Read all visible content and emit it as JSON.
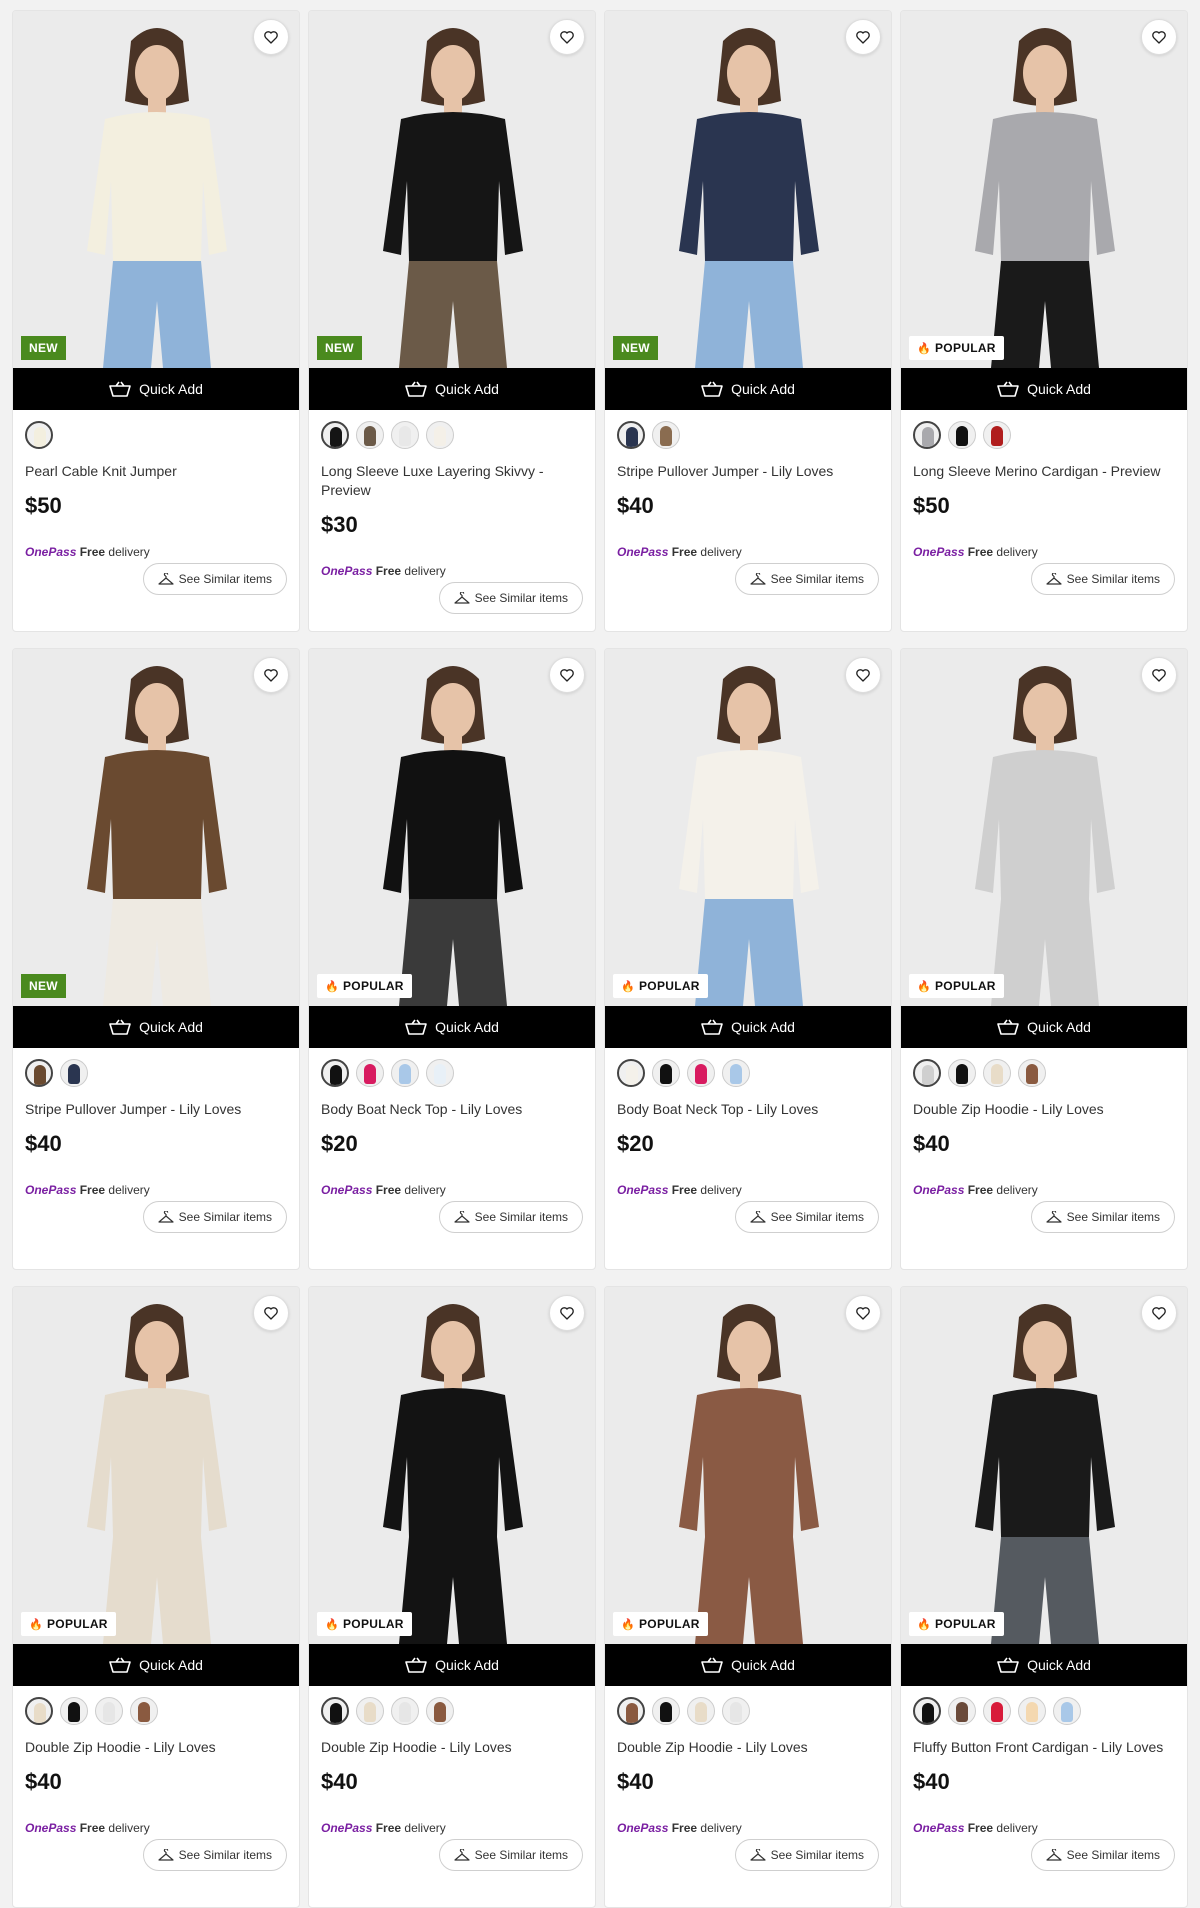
{
  "quick_add_label": "Quick Add",
  "similar_label": "See Similar items",
  "delivery": {
    "brand": "OnePass",
    "free": "Free",
    "text": "delivery"
  },
  "colors": {
    "new_badge": "#4a8a1e",
    "onepass": "#7a1fa2",
    "quick_bar": "#000000"
  },
  "products": [
    {
      "name": "Pearl Cable Knit Jumper",
      "price": "$50",
      "badge": "NEW",
      "top": "#f3efdf",
      "bottom": "#8fb3d9",
      "swatches": [
        "#f3efdf"
      ]
    },
    {
      "name": "Long Sleeve Luxe Layering Skivvy - Preview",
      "price": "$30",
      "badge": "NEW",
      "top": "#151515",
      "bottom": "#6b5a48",
      "swatches": [
        "#151515",
        "#6b5a48",
        "#e8e8e8",
        "#f4f0e8"
      ]
    },
    {
      "name": "Stripe Pullover Jumper - Lily Loves",
      "price": "$40",
      "badge": "NEW",
      "top": "#2a3550",
      "bottom": "#8fb3d9",
      "swatches": [
        "#2a3550",
        "#8a6c50"
      ]
    },
    {
      "name": "Long Sleeve Merino Cardigan - Preview",
      "price": "$50",
      "badge": "POPULAR",
      "top": "#a9a9ad",
      "bottom": "#1a1a1a",
      "swatches": [
        "#a9a9ad",
        "#111111",
        "#b01d1d"
      ]
    },
    {
      "name": "Stripe Pullover Jumper - Lily Loves",
      "price": "$40",
      "badge": "NEW",
      "top": "#6a4a30",
      "bottom": "#eeeae2",
      "swatches": [
        "#6a4a30",
        "#2a3550"
      ]
    },
    {
      "name": "Body Boat Neck Top - Lily Loves",
      "price": "$20",
      "badge": "POPULAR",
      "top": "#111111",
      "bottom": "#3a3a3a",
      "swatches": [
        "#111111",
        "#d81b60",
        "#a9c8e8",
        "#e8f0f7"
      ]
    },
    {
      "name": "Body Boat Neck Top - Lily Loves",
      "price": "$20",
      "badge": "POPULAR",
      "top": "#f4f1ea",
      "bottom": "#8fb3d9",
      "swatches": [
        "#f4f1ea",
        "#111111",
        "#d81b60",
        "#a9c8e8"
      ]
    },
    {
      "name": "Double Zip Hoodie - Lily Loves",
      "price": "$40",
      "badge": "POPULAR",
      "top": "#cfcfcf",
      "bottom": "#cfcfcf",
      "swatches": [
        "#cfcfcf",
        "#111111",
        "#e8dcc8",
        "#8a5a40"
      ]
    },
    {
      "name": "Double Zip Hoodie - Lily Loves",
      "price": "$40",
      "badge": "POPULAR",
      "top": "#e5dccd",
      "bottom": "#e5dccd",
      "swatches": [
        "#e8dcc8",
        "#111111",
        "#e6e6e6",
        "#8a5a40"
      ]
    },
    {
      "name": "Double Zip Hoodie - Lily Loves",
      "price": "$40",
      "badge": "POPULAR",
      "top": "#131313",
      "bottom": "#131313",
      "swatches": [
        "#111111",
        "#e8dcc8",
        "#e6e6e6",
        "#8a5a40"
      ]
    },
    {
      "name": "Double Zip Hoodie - Lily Loves",
      "price": "$40",
      "badge": "POPULAR",
      "top": "#8a5a44",
      "bottom": "#8a5a44",
      "swatches": [
        "#8a5a40",
        "#111111",
        "#e8dcc8",
        "#e6e6e6"
      ]
    },
    {
      "name": "Fluffy Button Front Cardigan - Lily Loves",
      "price": "$40",
      "badge": "POPULAR",
      "top": "#1a1a1a",
      "bottom": "#555a60",
      "swatches": [
        "#111111",
        "#6a4a3a",
        "#d81b3a",
        "#f4d8b0",
        "#a9c8e8"
      ]
    }
  ]
}
